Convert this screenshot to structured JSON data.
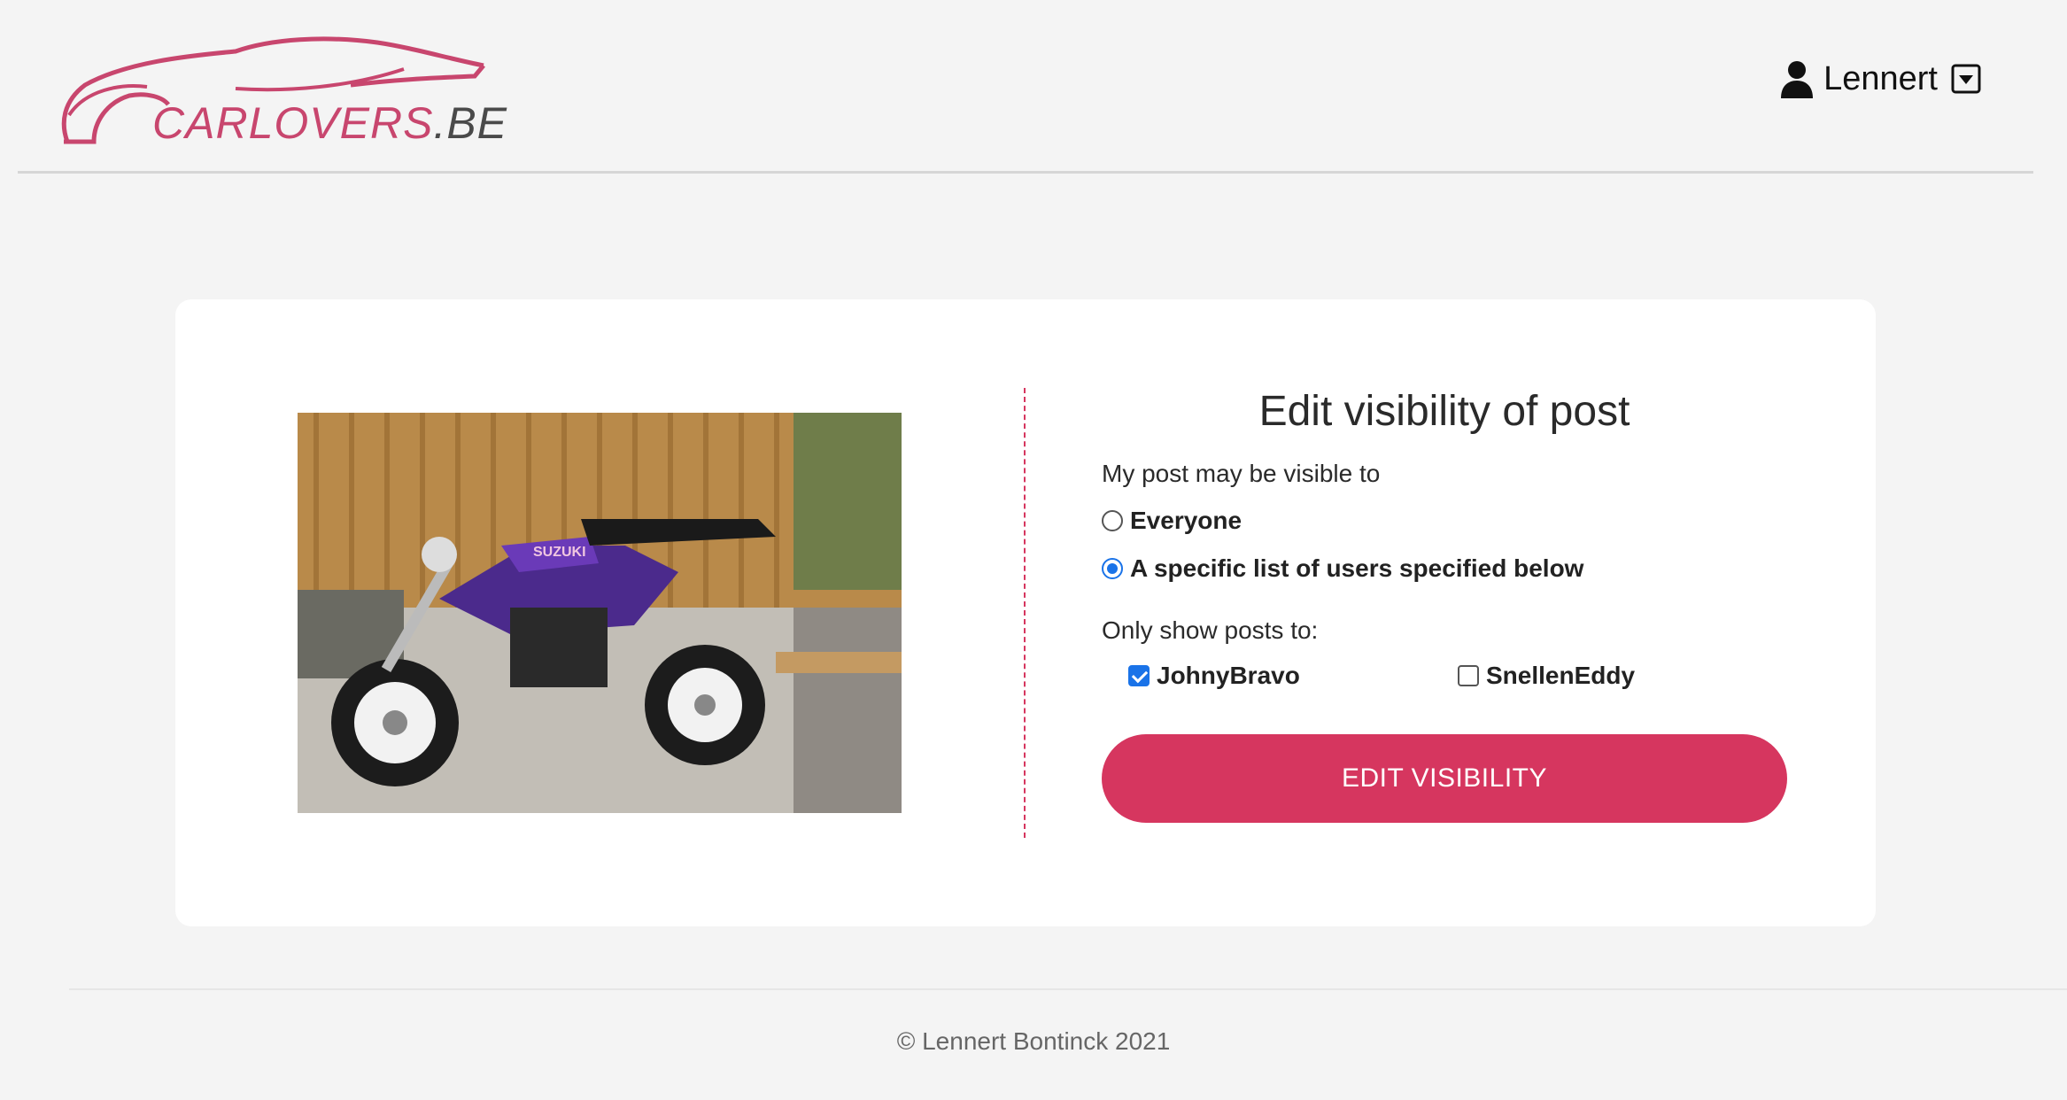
{
  "header": {
    "logo": {
      "brand": "CARLOVERS",
      "tld": ".BE"
    },
    "user": {
      "name": "Lennert",
      "icon": "user-icon",
      "menu_icon": "caret-down-box-icon"
    }
  },
  "colors": {
    "accent": "#d6365f",
    "logo": "#c8466e",
    "background": "#f4f4f4",
    "checkbox": "#1a73e8"
  },
  "post": {
    "image": "purple Suzuki motorcycle photo",
    "tank_text": "SUZUKI"
  },
  "form": {
    "title": "Edit visibility of post",
    "visibility_label": "My post may be visible to",
    "options": [
      {
        "label": "Everyone",
        "selected": false
      },
      {
        "label": "A specific list of users specified below",
        "selected": true
      }
    ],
    "users_label": "Only show posts to:",
    "users": [
      {
        "name": "JohnyBravo",
        "checked": true
      },
      {
        "name": "SnellenEddy",
        "checked": false
      }
    ],
    "submit_label": "EDIT VISIBILITY"
  },
  "footer": {
    "text": "© Lennert Bontinck 2021"
  }
}
